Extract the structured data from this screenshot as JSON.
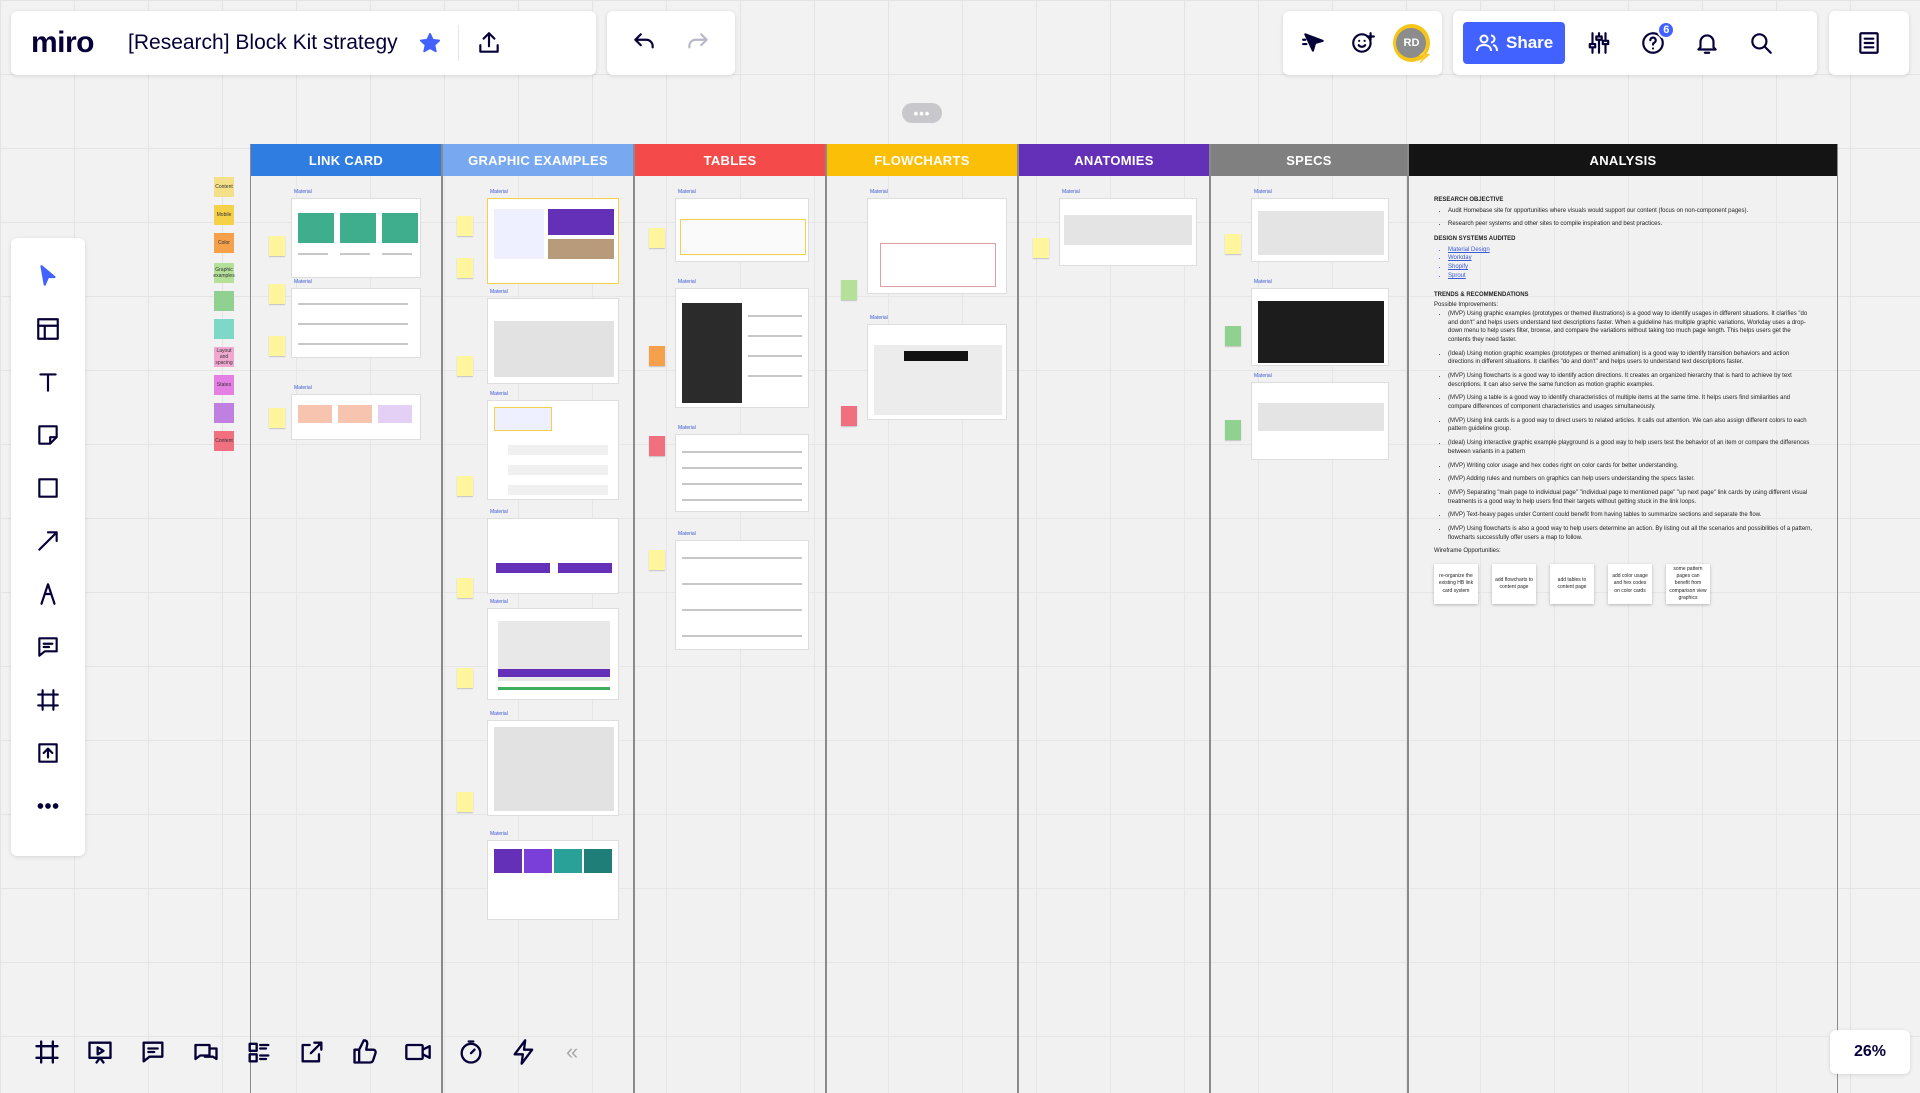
{
  "app": {
    "logo": "miro",
    "board_title": "[Research] Block Kit strategy"
  },
  "header": {
    "share_label": "Share",
    "avatar_initials": "RD",
    "help_badge": "6",
    "colors": {
      "share_bg": "#4262ff",
      "star": "#4262ff",
      "avatar_bg": "#f5c518",
      "badge_bg": "#4262ff"
    }
  },
  "toolbar_center": {
    "more_label": "•••"
  },
  "columns": [
    {
      "label": "LINK CARD",
      "color": "#2f7de1"
    },
    {
      "label": "GRAPHIC EXAMPLES",
      "color": "#78a8f0"
    },
    {
      "label": "TABLES",
      "color": "#f44a4a"
    },
    {
      "label": "FLOWCHARTS",
      "color": "#fbbf07"
    },
    {
      "label": "ANATOMIES",
      "color": "#6530b8"
    },
    {
      "label": "SPECS",
      "color": "#808080"
    },
    {
      "label": "ANALYSIS",
      "color": "#141414"
    }
  ],
  "tags": [
    {
      "label": "Content",
      "color": "#f5e08a"
    },
    {
      "label": "Mobile",
      "color": "#f5d14a"
    },
    {
      "label": "Color",
      "color": "#f5a04a"
    },
    {
      "label": "Graphic examples",
      "color": "#b4e09a"
    },
    {
      "label": "",
      "color": "#90d090"
    },
    {
      "label": "",
      "color": "#7dd8c8"
    },
    {
      "label": "Layout and spacing",
      "color": "#f0a8d0"
    },
    {
      "label": "States",
      "color": "#e480e4"
    },
    {
      "label": "",
      "color": "#c080e0"
    },
    {
      "label": "Content",
      "color": "#f07080"
    }
  ],
  "card_label": "Material",
  "analysis": {
    "objective_title": "RESEARCH OBJECTIVE",
    "objective_items": [
      "Audit Homebase site for opportunities where visuals would support our content (focus on non-component pages).",
      "Research peer systems and other sites to compile inspiration and best practices."
    ],
    "systems_title": "DESIGN SYSTEMS AUDITED",
    "systems": [
      "Material Design",
      "Workday",
      "Shopify",
      "Sprout"
    ],
    "trends_title": "TRENDS & RECOMMENDATIONS",
    "possible_label": "Possible Improvements:",
    "improvements": [
      "(MVP) Using graphic examples (prototypes or themed illustrations) is a good way to identify usages in different situations. It clarifies \"do and don't\" and helps users understand text descriptions faster. When a guideline has multiple graphic variations, Workday uses a drop-down menu to help users filter, browse, and compare the variations without taking too much page length. This helps users get the contents they need faster.",
      "(Ideal) Using motion graphic examples (prototypes or themed animation) is a good way to identify transition behaviors and action directions in different situations. It clarifies \"do and don't\" and helps users to understand text descriptions faster.",
      "(MVP) Using flowcharts is a good way to identify action directions. It creates an organized hierarchy that is hard to achieve by text descriptions. It can also serve the same function as motion graphic examples.",
      "(MVP) Using a table is a good way to identify characteristics of multiple items at the same time. It helps users find similarities and compare differences of component characteristics and usages simultaneously.",
      "(MVP) Using link cards is a good way to direct users to related articles. It calls out attention. We can also assign different colors to each pattern guideline group.",
      "(Ideal) Using interactive graphic example playground is a good way to help users test the behavior of an item or compare the differences between variants in a pattern",
      "(MVP) Writing color usage and hex codes right on color cards for better understanding.",
      "(MVP) Adding rules and numbers on graphics can help users understanding the specs faster.",
      "(MVP) Separating \"main page to individual page\" \"individual page to mentioned page\" \"up next page\" link cards by using different visual treatments is a good way to help users find their targets without getting stuck in the link loops.",
      "(MVP) Text-heavy pages under Content could benefit from having tables to summarize sections and separate the flow.",
      "(MVP) Using flowcharts is also a good way to help users determine an action. By listing out all the scenarios and possibilities of a pattern, flowcharts successfully offer users a map to follow."
    ],
    "wireframe_title": "Wireframe Opportunities:",
    "wireframes": [
      "re-organize the existing HB link card system",
      "add flowcharts to content page",
      "add tables to content page",
      "add color usage and hex codes on color cards",
      "some pattern pages can benefit from comparison view graphics"
    ]
  },
  "zoom": "26%",
  "collapse_label": "«"
}
